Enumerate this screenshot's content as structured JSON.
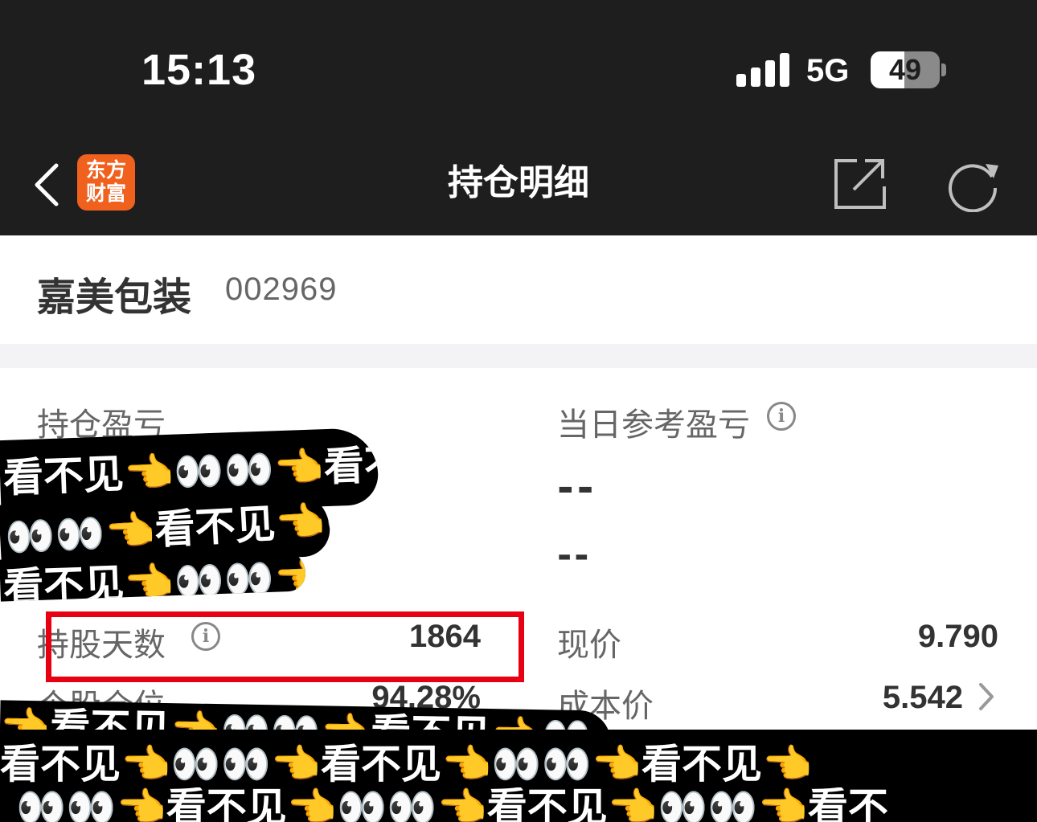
{
  "status_bar": {
    "time": "15:13",
    "network": "5G",
    "battery_percent": "49",
    "battery_level": 0.49
  },
  "nav": {
    "back_icon": "chevron-left-icon",
    "logo_line1": "东方",
    "logo_line2": "财富",
    "title": "持仓明细",
    "share_icon": "share-icon",
    "refresh_icon": "refresh-icon",
    "logo_color": "#f0611e"
  },
  "stock": {
    "name": "嘉美包装",
    "code": "002969"
  },
  "panel": {
    "position_pnl_label": "持仓盈亏",
    "daily_pnl_label": "当日参考盈亏",
    "daily_pnl_value": "--",
    "daily_pnl_percent": "--",
    "holding_days_label": "持股天数",
    "holding_days_value": "1864",
    "current_price_label": "现价",
    "current_price_value": "9.790",
    "position_ratio_label": "个股仓位",
    "position_ratio_value": "94.28%",
    "cost_price_label": "成本价",
    "cost_price_value": "5.542"
  },
  "overlay": {
    "censor_text_1": "看不见👈👀👀👈看不见",
    "censor_text_2": "👀👀👈看不见👈👀",
    "censor_text_3": "看不见👈👀👀👈",
    "censor_text_4": "看不见👈👀👀👈看不见👈👀👀👈看不见👈",
    "censor_text_5": "👀👀👈看不见👈👀👀👈看不见👈👀👀👈看不",
    "censor_text_6": "👈看不见👈👀👀👈看不见👈👀",
    "highlight_color": "#e60012"
  }
}
